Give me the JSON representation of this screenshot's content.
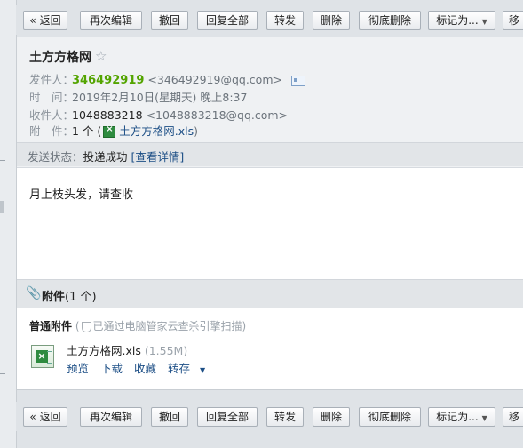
{
  "toolbar": {
    "back": "« 返回",
    "reedit": "再次编辑",
    "recall": "撤回",
    "reply_all": "回复全部",
    "forward": "转发",
    "delete": "删除",
    "delete_forever": "彻底删除",
    "mark_as": "标记为...",
    "move_partial": "移"
  },
  "mail": {
    "subject": "土方方格网",
    "sender_label": "发件人：",
    "sender_name": "346492919",
    "sender_email": "<346492919@qq.com>",
    "time_label": "时　间：",
    "time_value": "2019年2月10日(星期天) 晚上8:37",
    "recipient_label": "收件人：",
    "recipient_name": "1048883218",
    "recipient_email": "<1048883218@qq.com>",
    "attach_label": "附　件：",
    "attach_count": "1 个 (",
    "attach_file": "土方方格网.xls",
    "attach_close": ")",
    "status_label": "发送状态：",
    "status_value": "投递成功",
    "status_link": "[查看详情]"
  },
  "body": {
    "text": "月上枝头发，请查收"
  },
  "attachments": {
    "header": "附件",
    "count": "(1 个)",
    "normal_label": "普通附件",
    "scan_note_open": "(",
    "scan_note": "已通过电脑管家云查杀引擎扫描)",
    "file_name": "土方方格网.xls",
    "file_size": "(1.55M)",
    "action_preview": "预览",
    "action_download": "下载",
    "action_save": "收藏",
    "action_transfer": "转存"
  },
  "icons": {
    "star": "star-outline-icon",
    "contact": "contact-card-icon",
    "paperclip": "paperclip-icon",
    "shield": "shield-icon",
    "xls": "excel-file-icon"
  }
}
